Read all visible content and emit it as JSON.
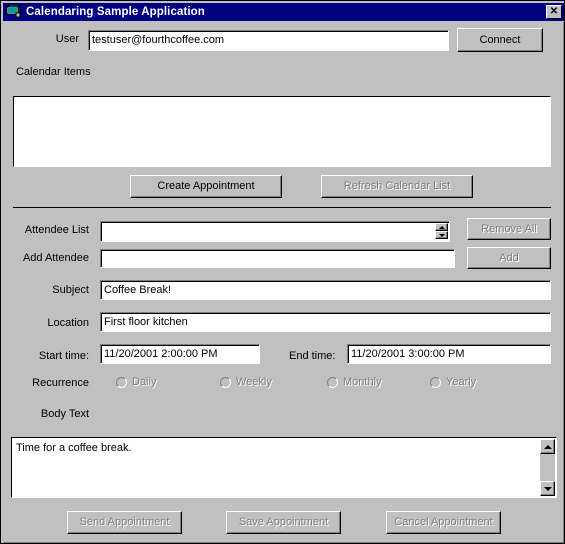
{
  "window": {
    "title": "Calendaring Sample Application",
    "icon": "vb-form-icon",
    "close_label": "✕",
    "background_color": "#c0c0c0",
    "titlebar_color": "#000080",
    "titlebar_text_color": "#ffffff",
    "disabled_text_color": "#808080"
  },
  "user_row": {
    "label": "User",
    "value": "testuser@fourthcoffee.com",
    "placeholder": "",
    "connect_label": "Connect",
    "connect_enabled": true
  },
  "calendar_section": {
    "label": "Calendar Items",
    "list_items": [],
    "create_appointment_label": "Create Appointment",
    "create_appointment_enabled": true,
    "refresh_label": "Refresh Calendar List",
    "refresh_enabled": false
  },
  "appointment": {
    "attendee_list": {
      "label": "Attendee List",
      "value": "",
      "remove_all_label": "Remove All",
      "remove_all_enabled": false
    },
    "add_attendee": {
      "label": "Add Attendee",
      "value": "",
      "add_label": "Add",
      "add_enabled": false
    },
    "subject": {
      "label": "Subject",
      "value": "Coffee Break!"
    },
    "location": {
      "label": "Location",
      "value": "First floor kitchen"
    },
    "start_time": {
      "label": "Start time:",
      "value": "11/20/2001 2:00:00 PM"
    },
    "end_time": {
      "label": "End time:",
      "value": "11/20/2001 3:00:00 PM"
    },
    "recurrence": {
      "label": "Recurrence",
      "options": [
        {
          "label": "Daily",
          "selected": false,
          "enabled": false
        },
        {
          "label": "Weekly",
          "selected": false,
          "enabled": false
        },
        {
          "label": "Monthly",
          "selected": false,
          "enabled": false
        },
        {
          "label": "Yearly",
          "selected": false,
          "enabled": false
        }
      ]
    },
    "body": {
      "label": "Body Text",
      "value": "Time for a coffee break."
    }
  },
  "actions": {
    "send_label": "Send Appointment",
    "send_enabled": false,
    "save_label": "Save Appointment",
    "save_enabled": false,
    "cancel_label": "Cancel Appointment",
    "cancel_enabled": false
  }
}
